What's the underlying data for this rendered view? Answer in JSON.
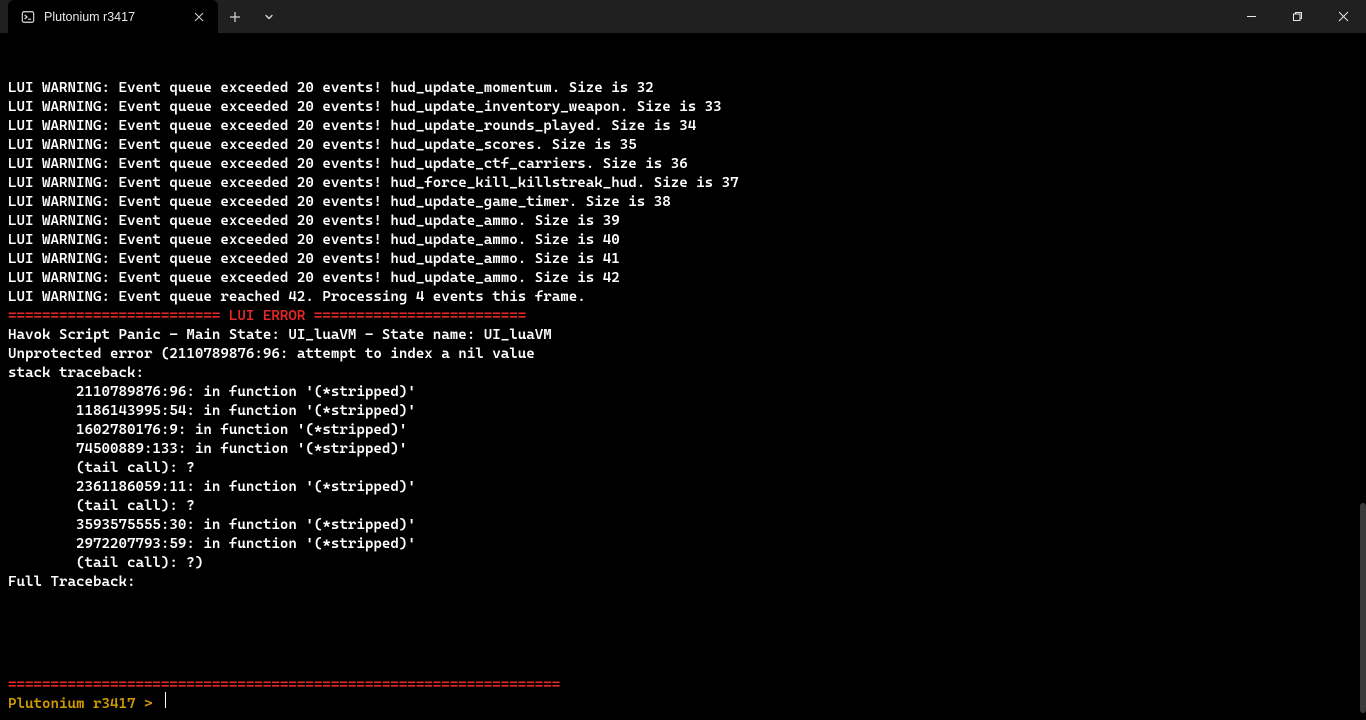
{
  "window": {
    "tab_title": "Plutonium r3417"
  },
  "console": {
    "warnings": [
      "LUI WARNING: Event queue exceeded 20 events! hud_update_momentum. Size is 32",
      "LUI WARNING: Event queue exceeded 20 events! hud_update_inventory_weapon. Size is 33",
      "LUI WARNING: Event queue exceeded 20 events! hud_update_rounds_played. Size is 34",
      "LUI WARNING: Event queue exceeded 20 events! hud_update_scores. Size is 35",
      "LUI WARNING: Event queue exceeded 20 events! hud_update_ctf_carriers. Size is 36",
      "LUI WARNING: Event queue exceeded 20 events! hud_force_kill_killstreak_hud. Size is 37",
      "LUI WARNING: Event queue exceeded 20 events! hud_update_game_timer. Size is 38",
      "LUI WARNING: Event queue exceeded 20 events! hud_update_ammo. Size is 39",
      "LUI WARNING: Event queue exceeded 20 events! hud_update_ammo. Size is 40",
      "LUI WARNING: Event queue exceeded 20 events! hud_update_ammo. Size is 41",
      "LUI WARNING: Event queue exceeded 20 events! hud_update_ammo. Size is 42",
      "LUI WARNING: Event queue reached 42. Processing 4 events this frame."
    ],
    "error_banner": "========================= LUI ERROR =========================",
    "panic_line": "Havok Script Panic - Main State: UI_luaVM - State name: UI_luaVM",
    "blank1": "",
    "blank2": "",
    "error_detail": "Unprotected error (2110789876:96: attempt to index a nil value",
    "traceback_header": "stack traceback:",
    "traceback": [
      "        2110789876:96: in function '(*stripped)'",
      "        1186143995:54: in function '(*stripped)'",
      "        1602780176:9: in function '(*stripped)'",
      "        74500889:133: in function '(*stripped)'",
      "        (tail call): ?",
      "        2361186059:11: in function '(*stripped)'",
      "        (tail call): ?",
      "        3593575555:30: in function '(*stripped)'",
      "        2972207793:59: in function '(*stripped)'",
      "        (tail call): ?)"
    ],
    "blank3": "",
    "blank4": "",
    "full_traceback_header": "Full Traceback:",
    "separator": "=================================================================",
    "prompt": "Plutonium r3417 > "
  }
}
